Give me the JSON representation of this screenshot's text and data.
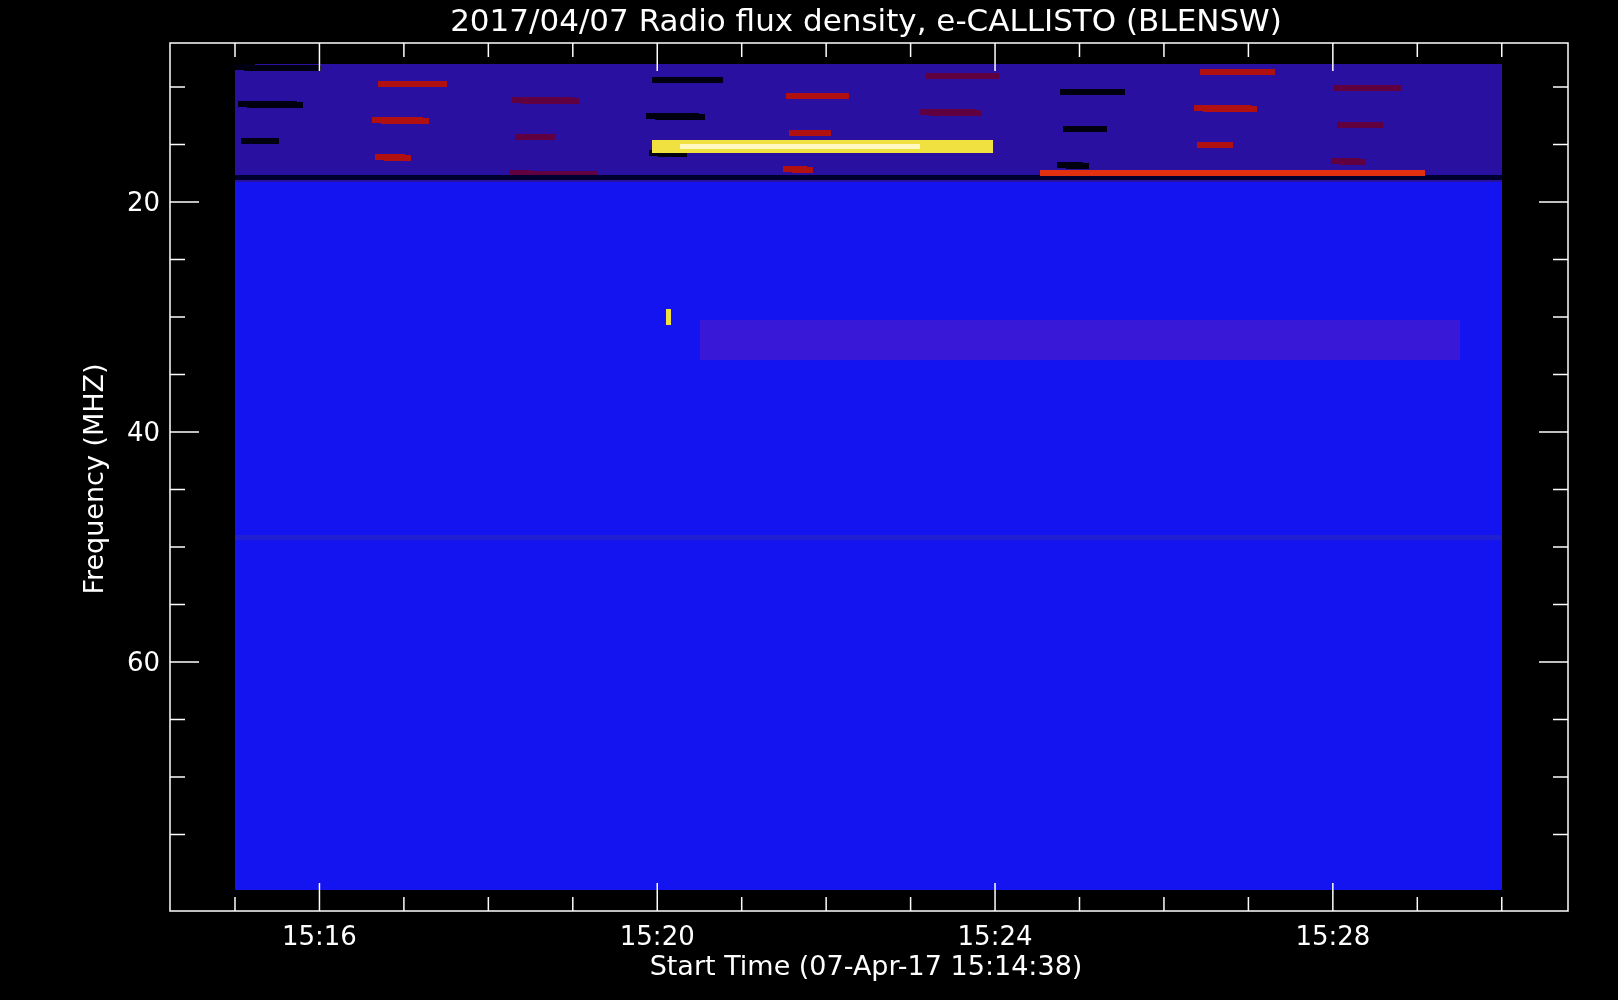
{
  "plot": {
    "title": "2017/04/07  Radio flux density, e-CALLISTO (BLENSW)",
    "ylabel": "Frequency (MHZ)",
    "xlabel": "Start Time (07-Apr-17 15:14:38)",
    "yticks": [
      "20",
      "40",
      "60"
    ],
    "xticks": [
      "15:16",
      "15:20",
      "15:24",
      "15:28"
    ]
  }
}
